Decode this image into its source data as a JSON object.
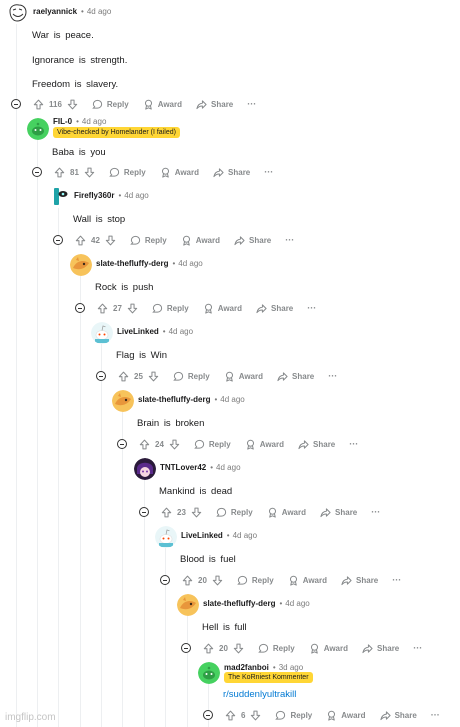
{
  "actions": {
    "reply_label": "Reply",
    "award_label": "Award",
    "share_label": "Share",
    "more_label": "···"
  },
  "comments": [
    {
      "username": "raelyannick",
      "time": "4d ago",
      "flair": "",
      "body": [
        "War  is  peace.",
        "Ignorance  is  strength.",
        "Freedom  is  slavery."
      ],
      "score": "116",
      "avatar_icon": "trollface-avatar-icon"
    },
    {
      "username": "FIL-0",
      "time": "4d ago",
      "flair": "Vibe-checked  by  Homelander  (I  failed)",
      "body": [
        "Baba  is  you"
      ],
      "score": "81",
      "avatar_icon": "green-snoo-avatar-icon"
    },
    {
      "username": "Firefly360r",
      "time": "4d ago",
      "flair": "",
      "body": [
        "Wall  is  stop"
      ],
      "score": "42",
      "avatar_icon": "teal-character-avatar-icon"
    },
    {
      "username": "slate-thefluffy-derg",
      "time": "4d ago",
      "flair": "",
      "body": [
        "Rock  is  push"
      ],
      "score": "27",
      "avatar_icon": "orange-dragon-avatar-icon"
    },
    {
      "username": "LiveLinked",
      "time": "4d ago",
      "flair": "",
      "body": [
        "Flag  is  Win"
      ],
      "score": "25",
      "avatar_icon": "snoo-avatar-icon"
    },
    {
      "username": "slate-thefluffy-derg",
      "time": "4d ago",
      "flair": "",
      "body": [
        "Brain  is  broken"
      ],
      "score": "24",
      "avatar_icon": "orange-dragon-avatar-icon"
    },
    {
      "username": "TNTLover42",
      "time": "4d ago",
      "flair": "",
      "body": [
        "Mankind  is  dead"
      ],
      "score": "23",
      "avatar_icon": "purple-anime-avatar-icon"
    },
    {
      "username": "LiveLinked",
      "time": "4d ago",
      "flair": "",
      "body": [
        "Blood  is  fuel"
      ],
      "score": "20",
      "avatar_icon": "snoo-avatar-icon"
    },
    {
      "username": "slate-thefluffy-derg",
      "time": "4d ago",
      "flair": "",
      "body": [
        "Hell  is  full"
      ],
      "score": "20",
      "avatar_icon": "orange-dragon-avatar-icon"
    },
    {
      "username": "mad2fanboi",
      "time": "3d ago",
      "flair": "The  KoRniest  Kommenter",
      "body": [
        "r/suddenlyultrakill"
      ],
      "score": "6",
      "avatar_icon": "green-snoo-avatar-icon"
    }
  ],
  "watermark": "imgflip.com",
  "colors": {
    "flair_bg": "#ffd635",
    "link": "#0079d3",
    "meta_gray": "#7c7c7c",
    "action_gray": "#878a8c"
  }
}
